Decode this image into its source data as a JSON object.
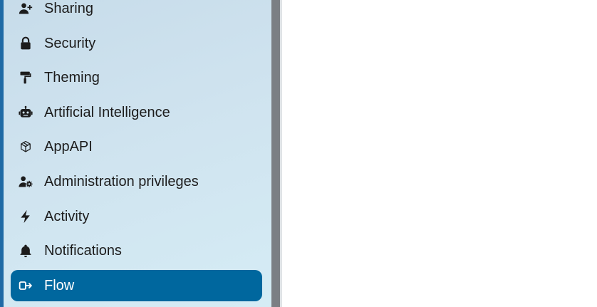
{
  "sidebar": {
    "active_item": "Flow",
    "items": [
      {
        "label": "Sharing",
        "icon": "user-plus-icon"
      },
      {
        "label": "Security",
        "icon": "lock-icon"
      },
      {
        "label": "Theming",
        "icon": "paint-roller-icon"
      },
      {
        "label": "Artificial Intelligence",
        "icon": "robot-icon"
      },
      {
        "label": "AppAPI",
        "icon": "cube-icon"
      },
      {
        "label": "Administration privileges",
        "icon": "user-gear-icon"
      },
      {
        "label": "Activity",
        "icon": "lightning-icon"
      },
      {
        "label": "Notifications",
        "icon": "bell-icon"
      },
      {
        "label": "Flow",
        "icon": "flow-arrow-icon"
      }
    ]
  },
  "colors": {
    "active_background": "#00679e",
    "sidebar_background": "#cfe3ef",
    "accent_border": "#1f6aa5",
    "scrollbar": "#7b7f84"
  }
}
